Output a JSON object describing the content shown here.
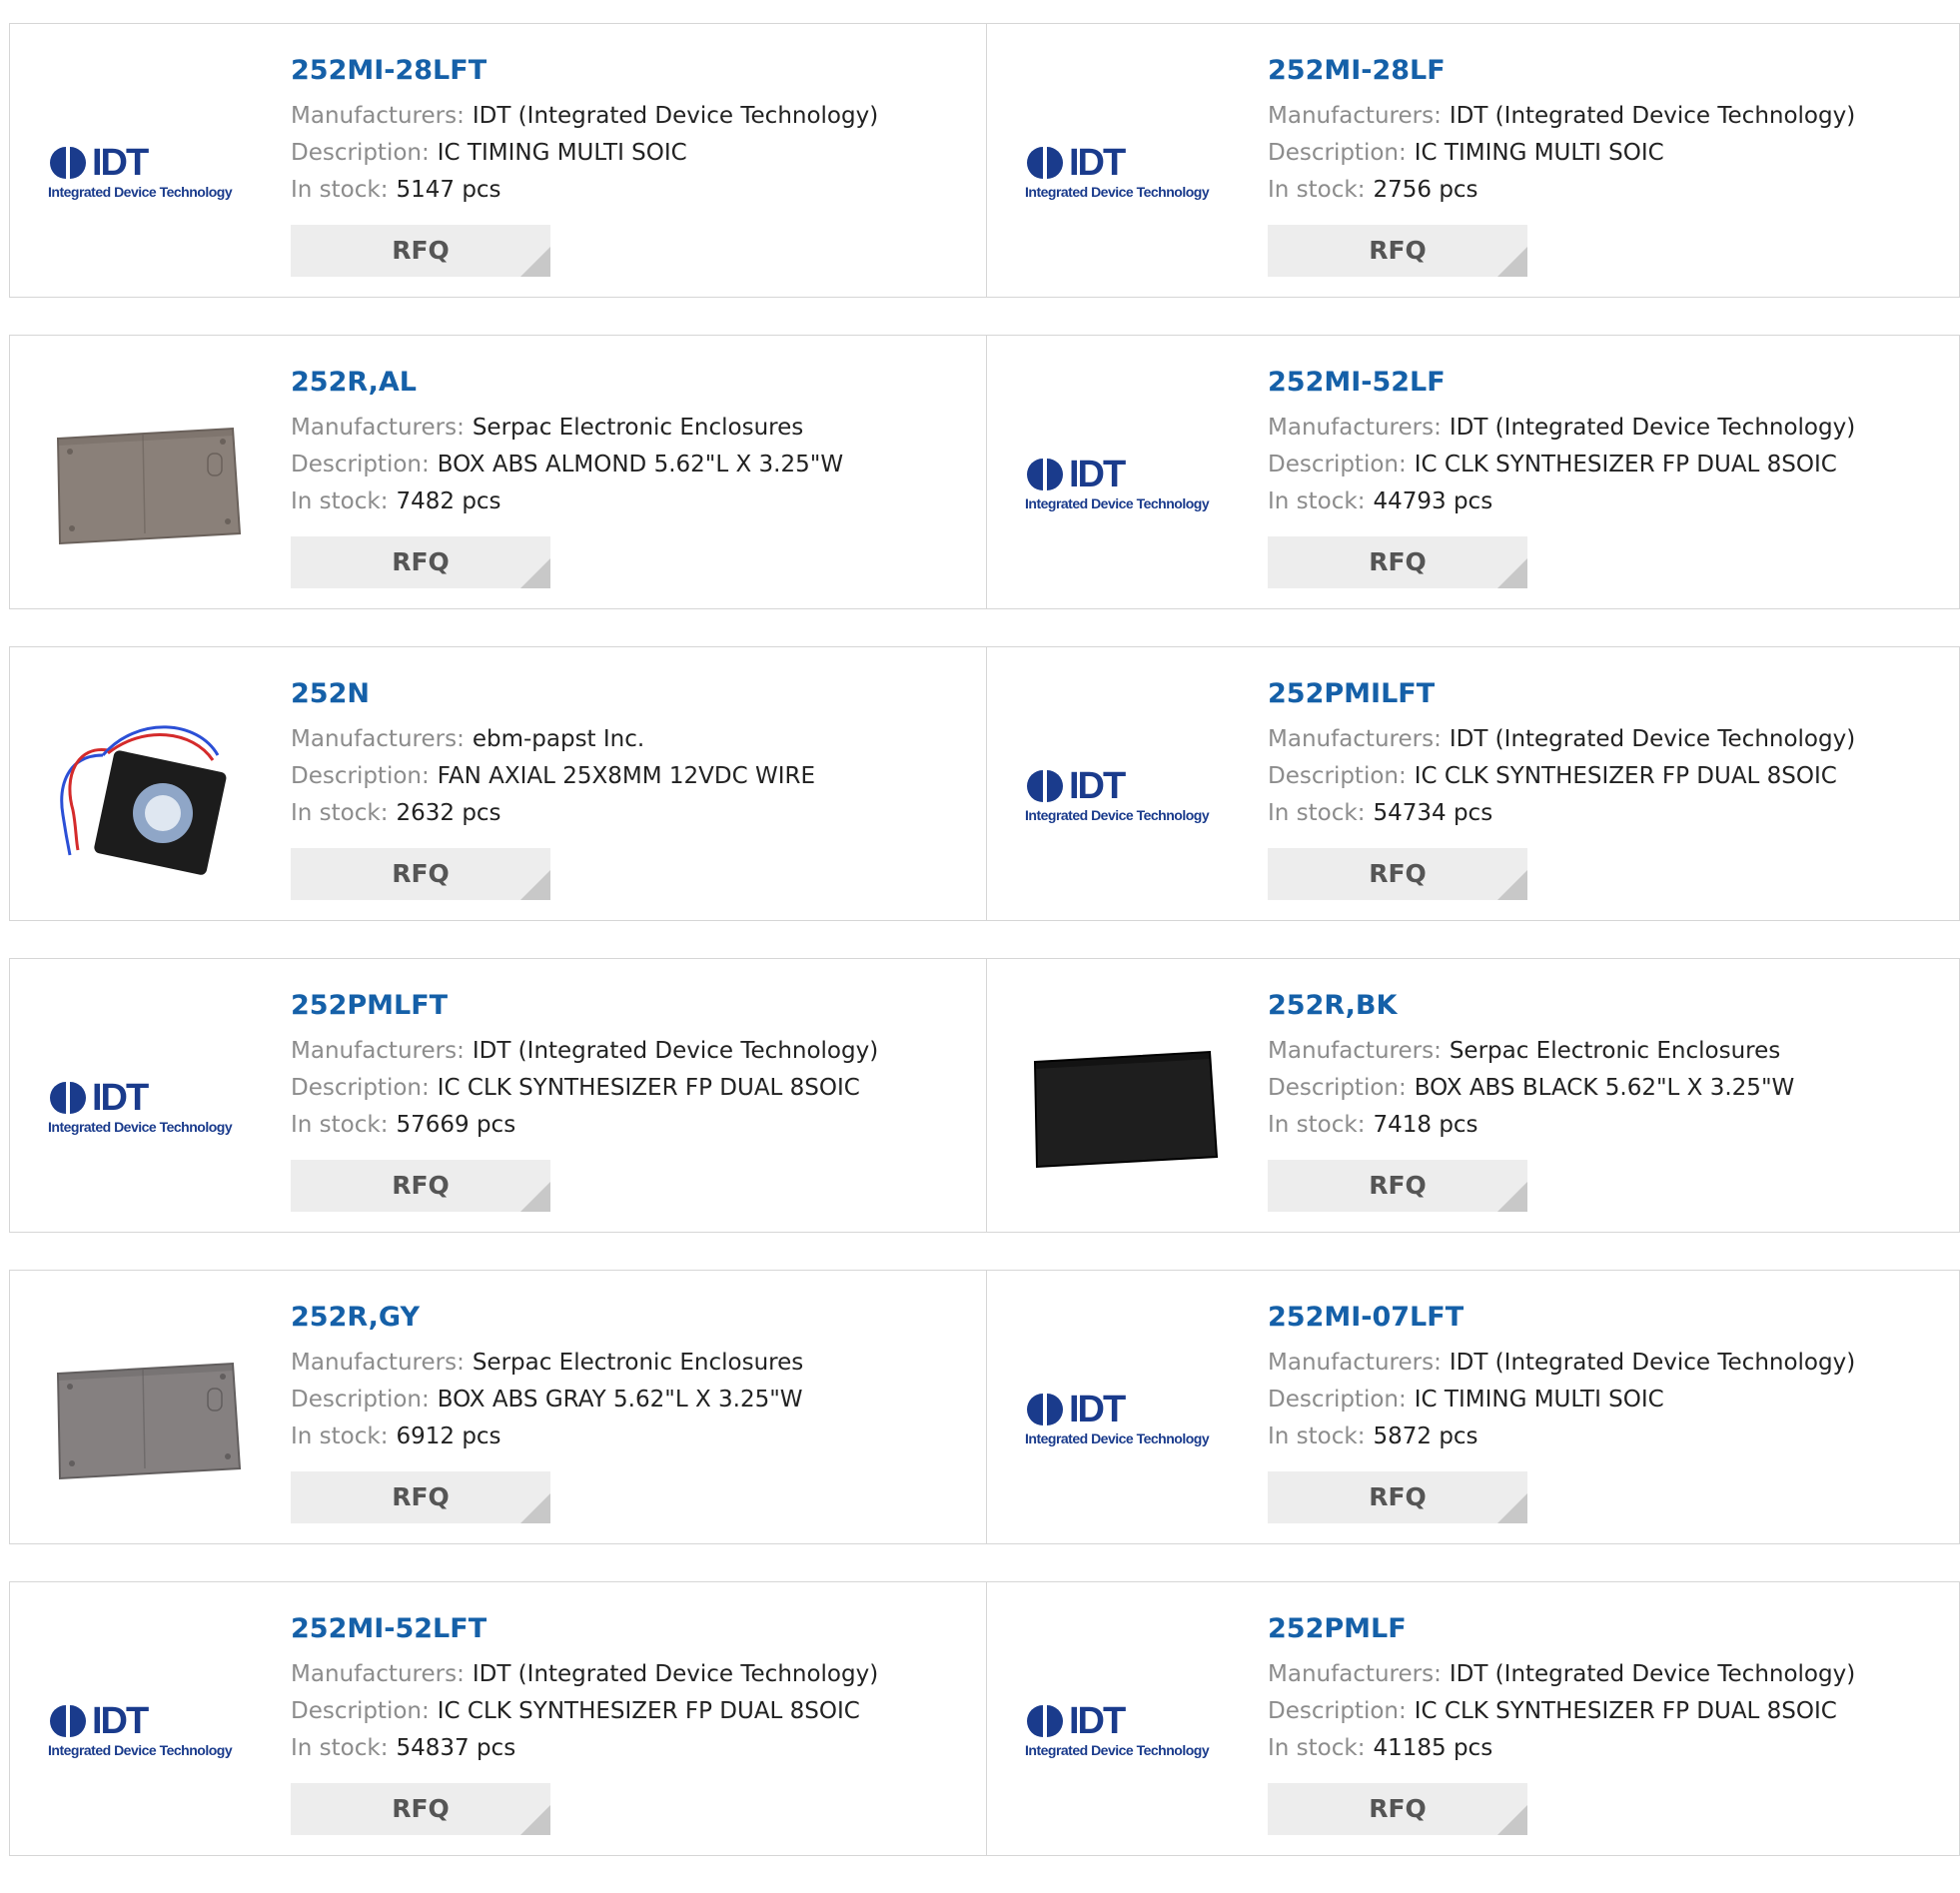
{
  "labels": {
    "manufacturers": "Manufacturers:",
    "description": "Description:",
    "in_stock": "In stock:",
    "rfq": "RFQ"
  },
  "logo": {
    "idt_word": "IDT",
    "idt_sub": "Integrated Device Technology"
  },
  "products": [
    {
      "part": "252MI-28LFT",
      "manufacturer": "IDT (Integrated Device Technology)",
      "description": "IC TIMING MULTI SOIC",
      "stock": "5147 pcs",
      "image": "idt-logo"
    },
    {
      "part": "252MI-28LF",
      "manufacturer": "IDT (Integrated Device Technology)",
      "description": "IC TIMING MULTI SOIC",
      "stock": "2756 pcs",
      "image": "idt-logo"
    },
    {
      "part": "252R,AL",
      "manufacturer": "Serpac Electronic Enclosures",
      "description": "BOX ABS ALMOND 5.62\"L X 3.25\"W",
      "stock": "7482 pcs",
      "image": "enclosure-almond"
    },
    {
      "part": "252MI-52LF",
      "manufacturer": "IDT (Integrated Device Technology)",
      "description": "IC CLK SYNTHESIZER FP DUAL 8SOIC",
      "stock": "44793 pcs",
      "image": "idt-logo"
    },
    {
      "part": "252N",
      "manufacturer": "ebm-papst Inc.",
      "description": "FAN AXIAL 25X8MM 12VDC WIRE",
      "stock": "2632 pcs",
      "image": "axial-fan"
    },
    {
      "part": "252PMILFT",
      "manufacturer": "IDT (Integrated Device Technology)",
      "description": "IC CLK SYNTHESIZER FP DUAL 8SOIC",
      "stock": "54734 pcs",
      "image": "idt-logo"
    },
    {
      "part": "252PMLFT",
      "manufacturer": "IDT (Integrated Device Technology)",
      "description": "IC CLK SYNTHESIZER FP DUAL 8SOIC",
      "stock": "57669 pcs",
      "image": "idt-logo"
    },
    {
      "part": "252R,BK",
      "manufacturer": "Serpac Electronic Enclosures",
      "description": "BOX ABS BLACK 5.62\"L X 3.25\"W",
      "stock": "7418 pcs",
      "image": "enclosure-black"
    },
    {
      "part": "252R,GY",
      "manufacturer": "Serpac Electronic Enclosures",
      "description": "BOX ABS GRAY 5.62\"L X 3.25\"W",
      "stock": "6912 pcs",
      "image": "enclosure-gray"
    },
    {
      "part": "252MI-07LFT",
      "manufacturer": "IDT (Integrated Device Technology)",
      "description": "IC TIMING MULTI SOIC",
      "stock": "5872 pcs",
      "image": "idt-logo"
    },
    {
      "part": "252MI-52LFT",
      "manufacturer": "IDT (Integrated Device Technology)",
      "description": "IC CLK SYNTHESIZER FP DUAL 8SOIC",
      "stock": "54837 pcs",
      "image": "idt-logo"
    },
    {
      "part": "252PMLF",
      "manufacturer": "IDT (Integrated Device Technology)",
      "description": "IC CLK SYNTHESIZER FP DUAL 8SOIC",
      "stock": "41185 pcs",
      "image": "idt-logo"
    }
  ],
  "colors": {
    "part_link": "#1560a8",
    "label": "#8c8c8c",
    "value": "#222222",
    "button_bg": "#ededed",
    "idt_blue": "#1a3b8c"
  }
}
